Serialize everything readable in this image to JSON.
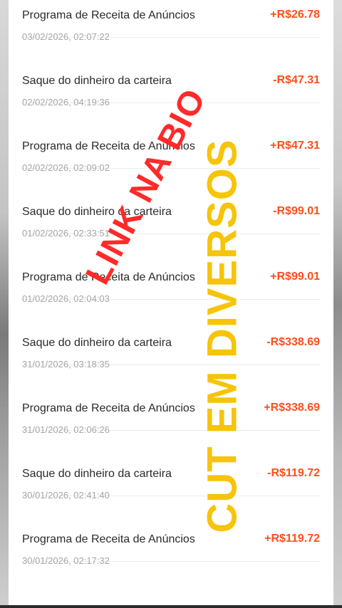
{
  "transactions": [
    {
      "title": "Programa de Receita de Anúncios",
      "date": "03/02/2026, 02:07:22",
      "amount": "+R$26.78"
    },
    {
      "title": "Saque do dinheiro da carteira",
      "date": "02/02/2026, 04:19:36",
      "amount": "-R$47.31"
    },
    {
      "title": "Programa de Receita de Anúncios",
      "date": "02/02/2026, 02:09:02",
      "amount": "+R$47.31"
    },
    {
      "title": "Saque do dinheiro da carteira",
      "date": "01/02/2026, 02:33:51",
      "amount": "-R$99.01"
    },
    {
      "title": "Programa de Receita de Anúncios",
      "date": "01/02/2026, 02:04:03",
      "amount": "+R$99.01"
    },
    {
      "title": "Saque do dinheiro da carteira",
      "date": "31/01/2026, 03:18:35",
      "amount": "-R$338.69"
    },
    {
      "title": "Programa de Receita de Anúncios",
      "date": "31/01/2026, 02:06:26",
      "amount": "+R$338.69"
    },
    {
      "title": "Saque do dinheiro da carteira",
      "date": "30/01/2026, 02:41:40",
      "amount": "-R$119.72"
    },
    {
      "title": "Programa de Receita de Anúncios",
      "date": "30/01/2026, 02:17:32",
      "amount": "+R$119.72"
    }
  ],
  "overlay": {
    "red_text": "LINK NA BIO",
    "yellow_text": "CUT EM DIVERSOS"
  },
  "colors": {
    "amount": "#ff4d1c",
    "overlay_red": "#ff2a2a",
    "overlay_yellow": "#f6c408"
  }
}
